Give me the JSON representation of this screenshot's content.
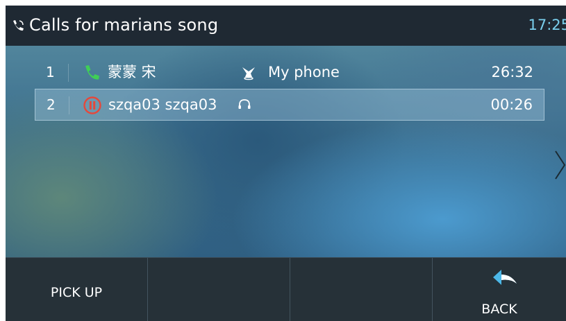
{
  "header": {
    "title": "Calls for marians song",
    "title_icon": "phone-calls-icon",
    "time": "17:25"
  },
  "calls": [
    {
      "index": "1",
      "status": "active",
      "status_icon": "phone-icon",
      "name": "蒙蒙 宋",
      "line_icon": "mobile-link-icon",
      "line_label": "My phone",
      "duration": "26:32"
    },
    {
      "index": "2",
      "status": "on-hold",
      "status_icon": "hold-icon",
      "name": "szqa03 szqa03",
      "line_icon": "headset-icon",
      "line_label": "",
      "duration": "00:26"
    }
  ],
  "softkeys": [
    {
      "label": "PICK UP"
    },
    {
      "label": ""
    },
    {
      "label": ""
    },
    {
      "label": "BACK",
      "icon": "back-arrow-icon"
    }
  ],
  "colors": {
    "header_bg": "#1f2933",
    "clock": "#7ad0ee",
    "active_call_icon": "#3fcf56",
    "hold_icon": "#e5483b",
    "back_icon": "#4cb8e8",
    "softkey_bg": "#263138"
  }
}
